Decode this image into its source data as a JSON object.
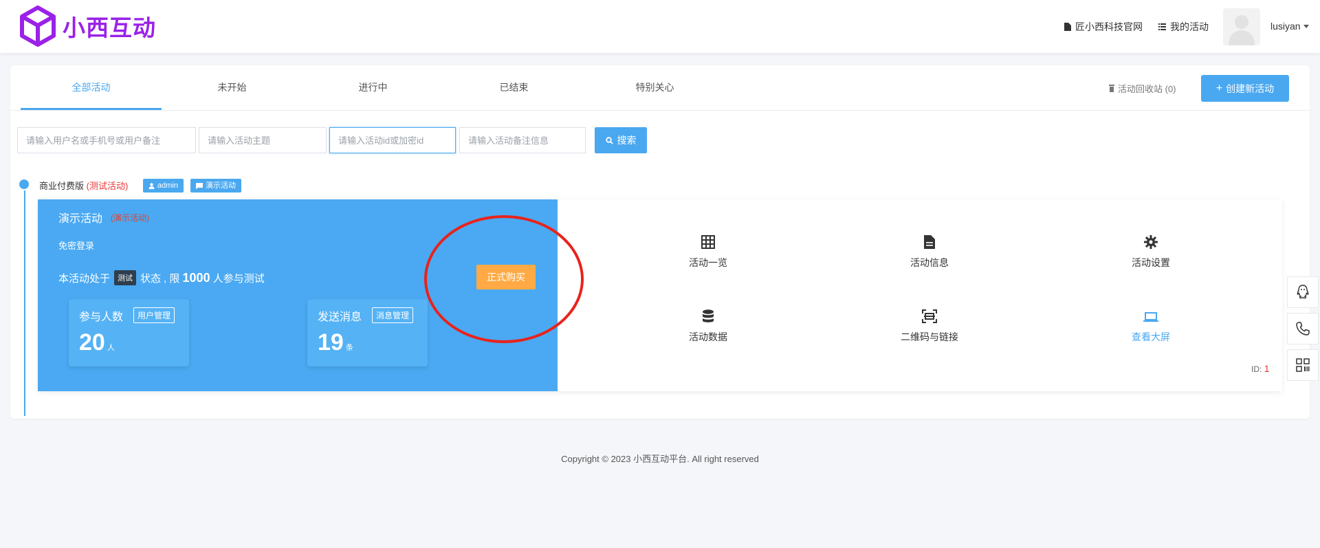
{
  "header": {
    "logo_text": "小西互动",
    "brand_color": "#9b21e8",
    "links": [
      {
        "label": "匠小西科技官网",
        "icon": "document-icon"
      },
      {
        "label": "我的活动",
        "icon": "list-icon"
      }
    ],
    "username": "lusiyan"
  },
  "tabs": [
    {
      "label": "全部活动",
      "active": true
    },
    {
      "label": "未开始",
      "active": false
    },
    {
      "label": "进行中",
      "active": false
    },
    {
      "label": "已结束",
      "active": false
    },
    {
      "label": "特别关心",
      "active": false
    }
  ],
  "toolbar": {
    "recycle_label": "活动回收站 (0)",
    "create_label": "创建新活动",
    "create_icon": "+"
  },
  "search": {
    "user_placeholder": "请输入用户名或手机号或用户备注",
    "topic_placeholder": "请输入活动主题",
    "id_placeholder": "请输入活动id或加密id",
    "note_placeholder": "请输入活动备注信息",
    "button_label": "搜索"
  },
  "group": {
    "title": "商业付费版",
    "tag": "(测试活动)",
    "badges": [
      {
        "label": "admin",
        "icon": "user-icon"
      },
      {
        "label": "演示活动",
        "icon": "message-icon"
      }
    ]
  },
  "event": {
    "title": "演示活动",
    "title_tag": "(演示活动)",
    "login_mode": "免密登录",
    "status_prefix": "本活动处于",
    "status_tag": "测试",
    "status_middle": "状态 , 限",
    "limit": "1000",
    "status_suffix": "人参与测试",
    "buy_label": "正式购买",
    "stats": [
      {
        "label": "参与人数",
        "tag": "用户管理",
        "value": "20",
        "unit": "人"
      },
      {
        "label": "发送消息",
        "tag": "消息管理",
        "value": "19",
        "unit": "条"
      }
    ],
    "actions": [
      {
        "label": "活动一览",
        "icon": "grid-icon"
      },
      {
        "label": "活动信息",
        "icon": "file-icon"
      },
      {
        "label": "活动设置",
        "icon": "gear-icon"
      },
      {
        "label": "活动数据",
        "icon": "database-icon"
      },
      {
        "label": "二维码与链接",
        "icon": "qrcode-scan-icon"
      },
      {
        "label": "查看大屏",
        "icon": "laptop-icon"
      }
    ],
    "id_label": "ID:",
    "id_value": "1"
  },
  "float_buttons": [
    {
      "icon": "qq-icon"
    },
    {
      "icon": "phone-icon"
    },
    {
      "icon": "qrcode-icon"
    }
  ],
  "footer": {
    "copyright": "Copyright © 2023 小西互动平台. All right reserved"
  },
  "colors": {
    "accent": "#4aa8f0",
    "event_panel": "#4aa9f2",
    "buy_button": "#ffaa44",
    "highlight_circle": "#e8231c"
  }
}
